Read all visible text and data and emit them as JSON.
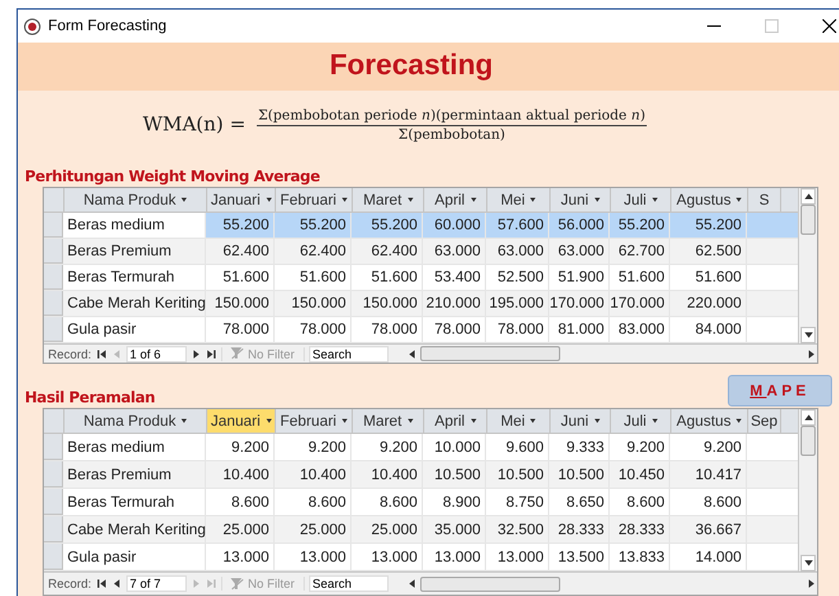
{
  "window": {
    "title": "Form Forecasting"
  },
  "header": {
    "title": "Forecasting"
  },
  "formula": {
    "lhs": "WMA(n) =",
    "numerator": "Σ(pembobotan periode *n*)(permintaan aktual periode *n*)",
    "denominator": "Σ(pembobotan)"
  },
  "wma_table": {
    "title": "Perhitungan Weight Moving Average",
    "columns": [
      {
        "label": "Nama Produk",
        "selected": false
      },
      {
        "label": "Januari",
        "selected": false
      },
      {
        "label": "Februari",
        "selected": false
      },
      {
        "label": "Maret",
        "selected": false
      },
      {
        "label": "April",
        "selected": false
      },
      {
        "label": "Mei",
        "selected": false
      },
      {
        "label": "Juni",
        "selected": false
      },
      {
        "label": "Juli",
        "selected": false
      },
      {
        "label": "Agustus",
        "selected": false
      },
      {
        "label": "S",
        "selected": false
      }
    ],
    "rows": [
      {
        "selected": true,
        "cells": [
          "Beras medium",
          "55.200",
          "55.200",
          "55.200",
          "60.000",
          "57.600",
          "56.000",
          "55.200",
          "55.200"
        ]
      },
      {
        "selected": false,
        "cells": [
          "Beras Premium",
          "62.400",
          "62.400",
          "62.400",
          "63.000",
          "63.000",
          "63.000",
          "62.700",
          "62.500"
        ]
      },
      {
        "selected": false,
        "cells": [
          "Beras Termurah",
          "51.600",
          "51.600",
          "51.600",
          "53.400",
          "52.500",
          "51.900",
          "51.600",
          "51.600"
        ]
      },
      {
        "selected": false,
        "cells": [
          "Cabe Merah Keriting",
          "150.000",
          "150.000",
          "150.000",
          "210.000",
          "195.000",
          "170.000",
          "170.000",
          "220.000"
        ]
      },
      {
        "selected": false,
        "cells": [
          "Gula pasir",
          "78.000",
          "78.000",
          "78.000",
          "78.000",
          "78.000",
          "81.000",
          "83.000",
          "84.000"
        ]
      }
    ],
    "navigation": {
      "label": "Record:",
      "position": "1 of 6",
      "filter": "No Filter",
      "search": "Search"
    }
  },
  "mape_button": {
    "label": "MAPE"
  },
  "forecast_table": {
    "title": "Hasil Peramalan",
    "columns": [
      {
        "label": "Nama Produk",
        "selected": false
      },
      {
        "label": "Januari",
        "selected": true
      },
      {
        "label": "Februari",
        "selected": false
      },
      {
        "label": "Maret",
        "selected": false
      },
      {
        "label": "April",
        "selected": false
      },
      {
        "label": "Mei",
        "selected": false
      },
      {
        "label": "Juni",
        "selected": false
      },
      {
        "label": "Juli",
        "selected": false
      },
      {
        "label": "Agustus",
        "selected": false
      },
      {
        "label": "Sep",
        "selected": false
      }
    ],
    "rows": [
      {
        "selected": false,
        "cells": [
          "Beras medium",
          "9.200",
          "9.200",
          "9.200",
          "10.000",
          "9.600",
          "9.333",
          "9.200",
          "9.200"
        ]
      },
      {
        "selected": false,
        "cells": [
          "Beras Premium",
          "10.400",
          "10.400",
          "10.400",
          "10.500",
          "10.500",
          "10.500",
          "10.450",
          "10.417"
        ]
      },
      {
        "selected": false,
        "cells": [
          "Beras Termurah",
          "8.600",
          "8.600",
          "8.600",
          "8.900",
          "8.750",
          "8.650",
          "8.600",
          "8.600"
        ]
      },
      {
        "selected": false,
        "cells": [
          "Cabe Merah Keriting",
          "25.000",
          "25.000",
          "25.000",
          "35.000",
          "32.500",
          "28.333",
          "28.333",
          "36.667"
        ]
      },
      {
        "selected": false,
        "cells": [
          "Gula pasir",
          "13.000",
          "13.000",
          "13.000",
          "13.000",
          "13.000",
          "13.500",
          "13.833",
          "14.000"
        ]
      }
    ],
    "navigation": {
      "label": "Record:",
      "position": "7 of 7",
      "filter": "No Filter",
      "search": "Search"
    }
  }
}
